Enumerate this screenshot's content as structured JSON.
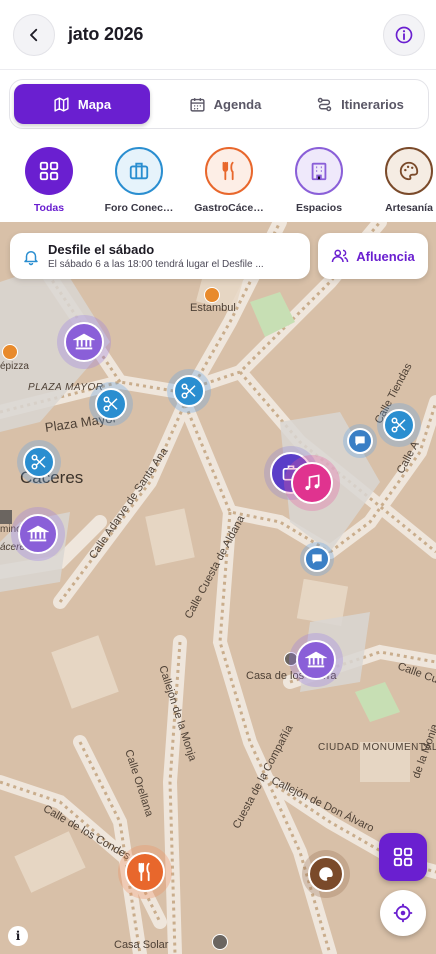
{
  "header": {
    "title": "jato 2026"
  },
  "tabs": [
    {
      "label": "Mapa",
      "icon": "map-icon",
      "active": true
    },
    {
      "label": "Agenda",
      "icon": "calendar-icon",
      "active": false
    },
    {
      "label": "Itinerarios",
      "icon": "route-icon",
      "active": false
    }
  ],
  "categories": [
    {
      "label": "Todas",
      "icon": "grid-icon",
      "color": "#6a1fd0",
      "active": true
    },
    {
      "label": "Foro Conec…",
      "icon": "briefcase-icon",
      "color": "#2a8ed0"
    },
    {
      "label": "GastroCáce…",
      "icon": "fork-knife-icon",
      "color": "#e8672c"
    },
    {
      "label": "Espacios",
      "icon": "building-icon",
      "color": "#8a5fd8"
    },
    {
      "label": "Artesanía",
      "icon": "palette-icon",
      "color": "#7a4a2a"
    }
  ],
  "notice": {
    "title": "Desfile el sábado",
    "text": "El sábado 6 a las 18:00 tendrá lugar el Desfile ..."
  },
  "afluencia": {
    "label": "Afluencia"
  },
  "map_labels": {
    "estambul": "Estambul",
    "pizza": "épizza",
    "plaza_mayor_caps": "PLAZA MAYOR",
    "plaza_mayor": "Plaza Mayor",
    "caceres": "Cáceres",
    "adarve": "Calle Adarve de Santa Ana",
    "cuesta_aldana": "Calle Cuesta de Aldana",
    "tiendas": "Calle Tiendas",
    "alba": "Calle A",
    "casa_sierra": "Casa de los Sierra",
    "callejon_monja": "Callejón de la Monja",
    "orellana": "Calle Orellana",
    "ciudad_monumental": "CIUDAD MONUMENTAL",
    "cuesta_compania": "Cuesta de la Compañía",
    "don_alvaro": "Callejón de Don Álvaro",
    "condes": "Calle de los Condes",
    "casa_solar": "Casa Solar",
    "cuesta": "Calle Cuesta",
    "monja_right": "de la Monja",
    "mino": "mino",
    "acere": "ácere"
  }
}
